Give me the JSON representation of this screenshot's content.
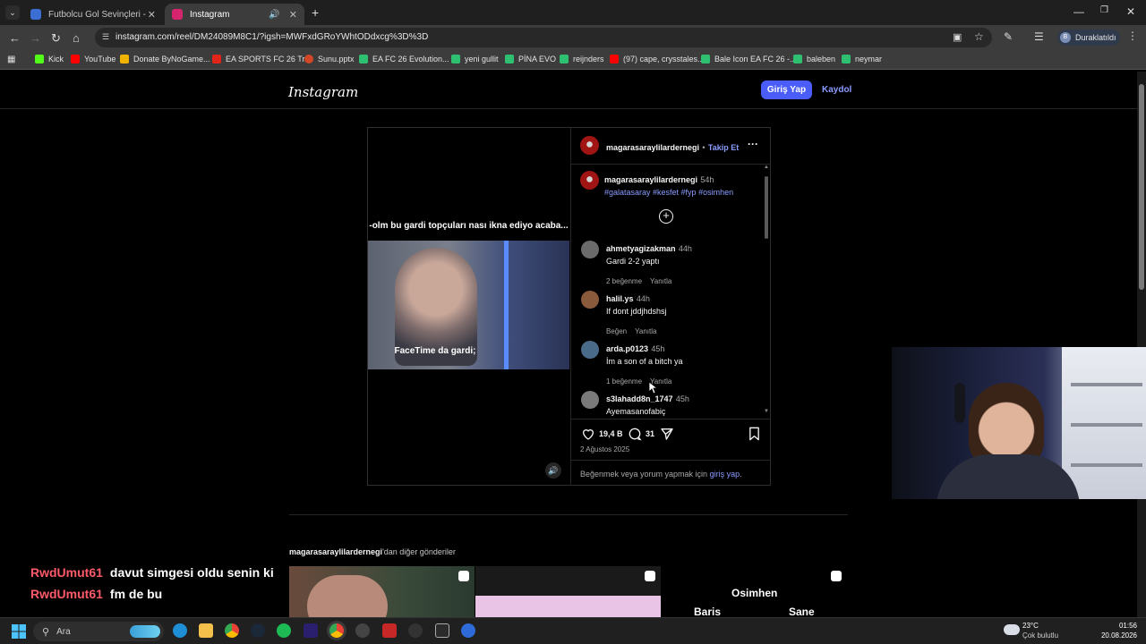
{
  "browser": {
    "tabs": [
      {
        "title": "Futbolcu Gol Sevinçleri - Tier Li",
        "favicon_color": "#3b6fd4",
        "active": false
      },
      {
        "title": "Instagram",
        "favicon_color": "#d6246e",
        "active": true
      }
    ],
    "new_tab_symbol": "+",
    "url": "instagram.com/reel/DM24089M8C1/?igsh=MWFxdGRoYWhtODdxcg%3D%3D",
    "profile_initial": "B",
    "profile_label": "Duraklatıldı",
    "bookmarks": [
      {
        "label": "Kick",
        "color": "#53fc18"
      },
      {
        "label": "YouTube",
        "color": "#ff0000"
      },
      {
        "label": "Donate ByNoGame...",
        "color": "#f0b400"
      },
      {
        "label": "EA SPORTS FC 26 Tr...",
        "color": "#e1251b"
      },
      {
        "label": "Sunu.pptx",
        "color": "#d24726"
      },
      {
        "label": "EA FC 26 Evolution...",
        "color": "#2fbf71"
      },
      {
        "label": "yeni gullit",
        "color": "#2fbf71"
      },
      {
        "label": "PİNA EVO",
        "color": "#2fbf71"
      },
      {
        "label": "reijnders",
        "color": "#2fbf71"
      },
      {
        "label": "(97) cape, crysstales...",
        "color": "#ff0000"
      },
      {
        "label": "Bale Icon EA FC 26 -...",
        "color": "#2fbf71"
      },
      {
        "label": "baleben",
        "color": "#2fbf71"
      },
      {
        "label": "neymar",
        "color": "#2fbf71"
      }
    ]
  },
  "instagram": {
    "logo": "Instagram",
    "login_button": "Giriş Yap",
    "signup_link": "Kaydol",
    "post": {
      "username": "magarasaraylilardernegi",
      "follow_sep": "•",
      "follow": "Takip Et",
      "more_symbol": "···",
      "video_caption_top": "-olm bu gardi topçuları nası ikna ediyo acaba...",
      "video_caption_bottom": "FaceTime da gardi;",
      "caption_user": "magarasaraylilardernegi",
      "caption_time": "54h",
      "caption_text": "#galatasaray #kesfet #fyp #osimhen",
      "comments": [
        {
          "user": "ahmetyagizakman",
          "time": "44h",
          "text": "Gardi 2-2 yaptı",
          "likes": "2 beğenme",
          "reply": "Yanıtla",
          "avatar_color": "#6b6b6b"
        },
        {
          "user": "halil.ys",
          "time": "44h",
          "text": "If dont jddjhdshsj",
          "likes": "Beğen",
          "reply": "Yanıtla",
          "avatar_color": "#8a5a3c"
        },
        {
          "user": "arda.p0123",
          "time": "45h",
          "text": "İm a son of a bitch ya",
          "likes": "1 beğenme",
          "reply": "Yanıtla",
          "avatar_color": "#4a6a8a"
        },
        {
          "user": "s3lahadd8n_1747",
          "time": "45h",
          "text": "Ayemasanofabiç",
          "likes": "",
          "reply": "",
          "avatar_color": "#7a7a7a"
        }
      ],
      "like_count": "19,4 B",
      "comment_count": "31",
      "date": "2 Ağustos 2025",
      "footer_prefix": "Beğenmek veya yorum yapmak için ",
      "footer_link": "giriş yap",
      "footer_suffix": "."
    },
    "more_posts_user": "magarasaraylilardernegi",
    "more_posts_suffix": "'dan diğer gönderiler",
    "thumb3_title": "Osimhen",
    "thumb3_left": "Baris",
    "thumb3_right": "Sane"
  },
  "chat": [
    {
      "user": "RwdUmut61",
      "message": "davut simgesi oldu senin ki"
    },
    {
      "user": "RwdUmut61",
      "message": "fm de bu"
    }
  ],
  "taskbar": {
    "search_placeholder": "Ara",
    "weather_temp": "23°C",
    "weather_desc": "Çok bulutlu",
    "time": "01:56",
    "date": "20.08.2026"
  }
}
